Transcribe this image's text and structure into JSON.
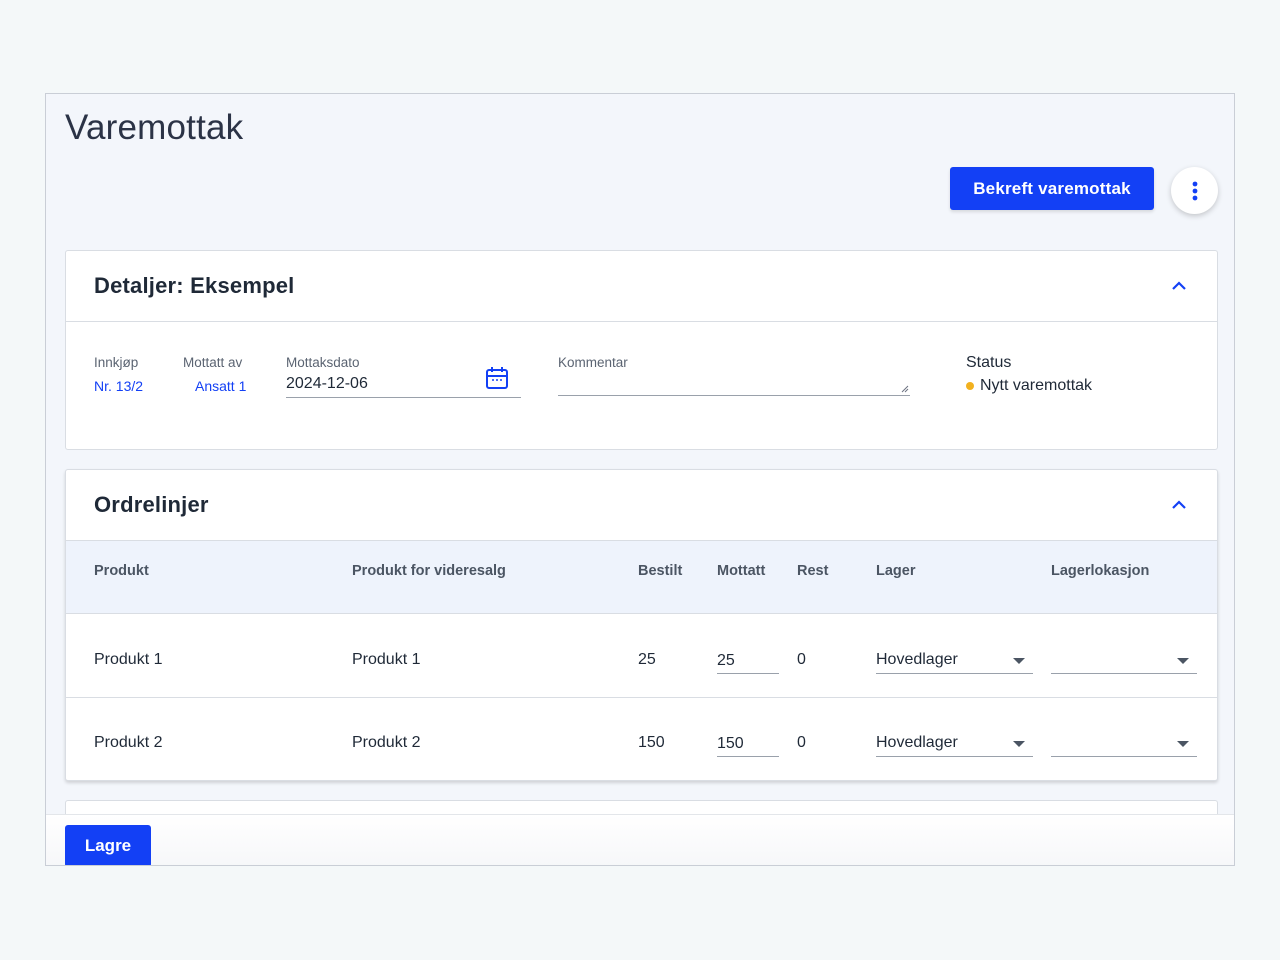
{
  "page": {
    "title": "Varemottak"
  },
  "actions": {
    "confirm_label": "Bekreft varemottak",
    "more_icon": "kebab-menu-icon"
  },
  "details": {
    "title": "Detaljer: Eksempel",
    "purchase_label": "Innkjøp",
    "purchase_value": "Nr. 13/2",
    "received_by_label": "Mottatt av",
    "received_by_value": "Ansatt 1",
    "date_label": "Mottaksdato",
    "date_value": "2024-12-06",
    "comment_label": "Kommentar",
    "comment_value": "",
    "status_label": "Status",
    "status_value": "Nytt varemottak",
    "status_color": "#f2b11f"
  },
  "order_lines": {
    "title": "Ordrelinjer",
    "columns": [
      "Produkt",
      "Produkt for videresalg",
      "Bestilt",
      "Mottatt",
      "Rest",
      "Lager",
      "Lagerlokasjon"
    ],
    "rows": [
      {
        "product": "Produkt 1",
        "resale_product": "Produkt 1",
        "ordered": "25",
        "received": "25",
        "rest": "0",
        "warehouse": "Hovedlager",
        "location": ""
      },
      {
        "product": "Produkt 2",
        "resale_product": "Produkt 2",
        "ordered": "150",
        "received": "150",
        "rest": "0",
        "warehouse": "Hovedlager",
        "location": ""
      }
    ]
  },
  "footer": {
    "save_label": "Lagre"
  },
  "colors": {
    "primary": "#1340f5",
    "background": "#f3f6fb"
  }
}
